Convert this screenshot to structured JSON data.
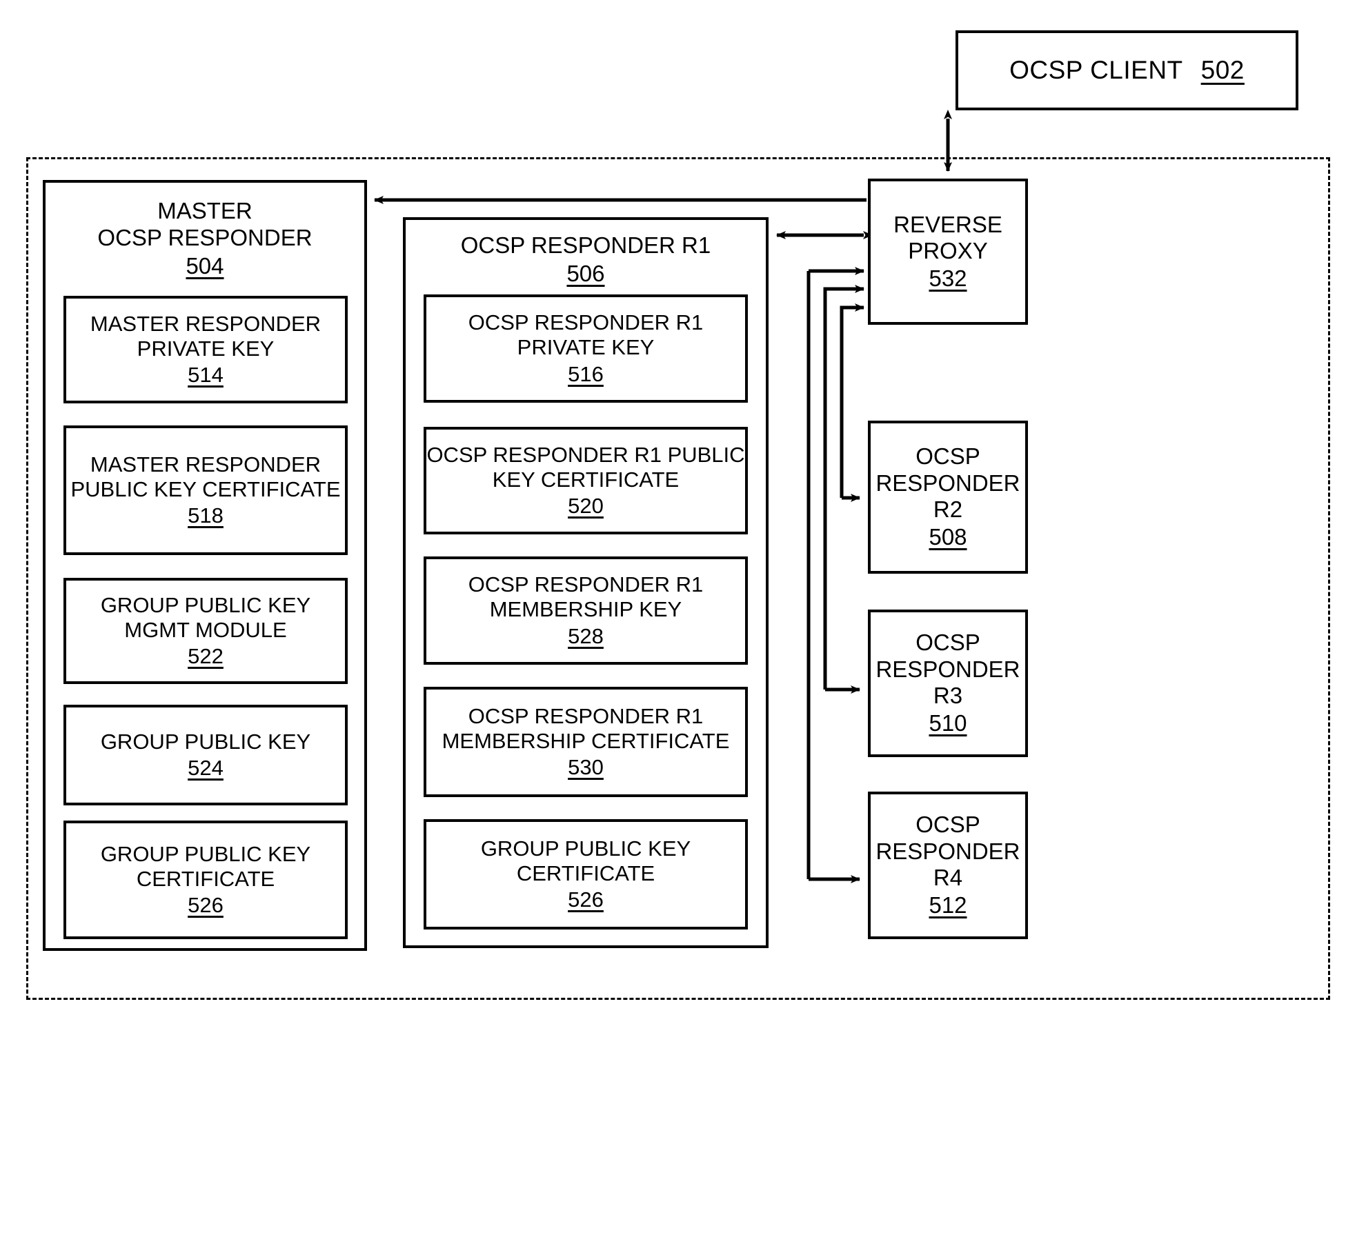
{
  "figure": {
    "type": "patent-block-diagram",
    "title": "OCSP responder group architecture"
  },
  "client": {
    "label": "OCSP CLIENT",
    "ref": "502"
  },
  "master": {
    "label": "MASTER\nOCSP RESPONDER",
    "ref": "504",
    "children": [
      {
        "label": "MASTER RESPONDER\nPRIVATE KEY",
        "ref": "514"
      },
      {
        "label": "MASTER RESPONDER\nPUBLIC KEY\nCERTIFICATE",
        "ref": "518"
      },
      {
        "label": "GROUP PUBLIC KEY\nMGMT MODULE",
        "ref": "522"
      },
      {
        "label": "GROUP PUBLIC KEY",
        "ref": "524"
      },
      {
        "label": "GROUP PUBLIC KEY\nCERTIFICATE",
        "ref": "526"
      }
    ]
  },
  "r1": {
    "label": "OCSP RESPONDER R1",
    "ref": "506",
    "children": [
      {
        "label": "OCSP RESPONDER R1\nPRIVATE KEY",
        "ref": "516"
      },
      {
        "label": "OCSP RESPONDER R1\nPUBLIC KEY CERTIFICATE",
        "ref": "520"
      },
      {
        "label": "OCSP RESPONDER R1\nMEMBERSHIP KEY",
        "ref": "528"
      },
      {
        "label": "OCSP RESPONDER R1\nMEMBERSHIP CERTIFICATE",
        "ref": "530"
      },
      {
        "label": "GROUP PUBLIC KEY\nCERTIFICATE",
        "ref": "526"
      }
    ]
  },
  "proxy": {
    "label": "REVERSE\nPROXY",
    "ref": "532"
  },
  "responders": [
    {
      "label": "OCSP\nRESPONDER\nR2",
      "ref": "508"
    },
    {
      "label": "OCSP\nRESPONDER\nR3",
      "ref": "510"
    },
    {
      "label": "OCSP\nRESPONDER\nR4",
      "ref": "512"
    }
  ],
  "colors": {
    "line": "#000000",
    "background": "#ffffff"
  }
}
